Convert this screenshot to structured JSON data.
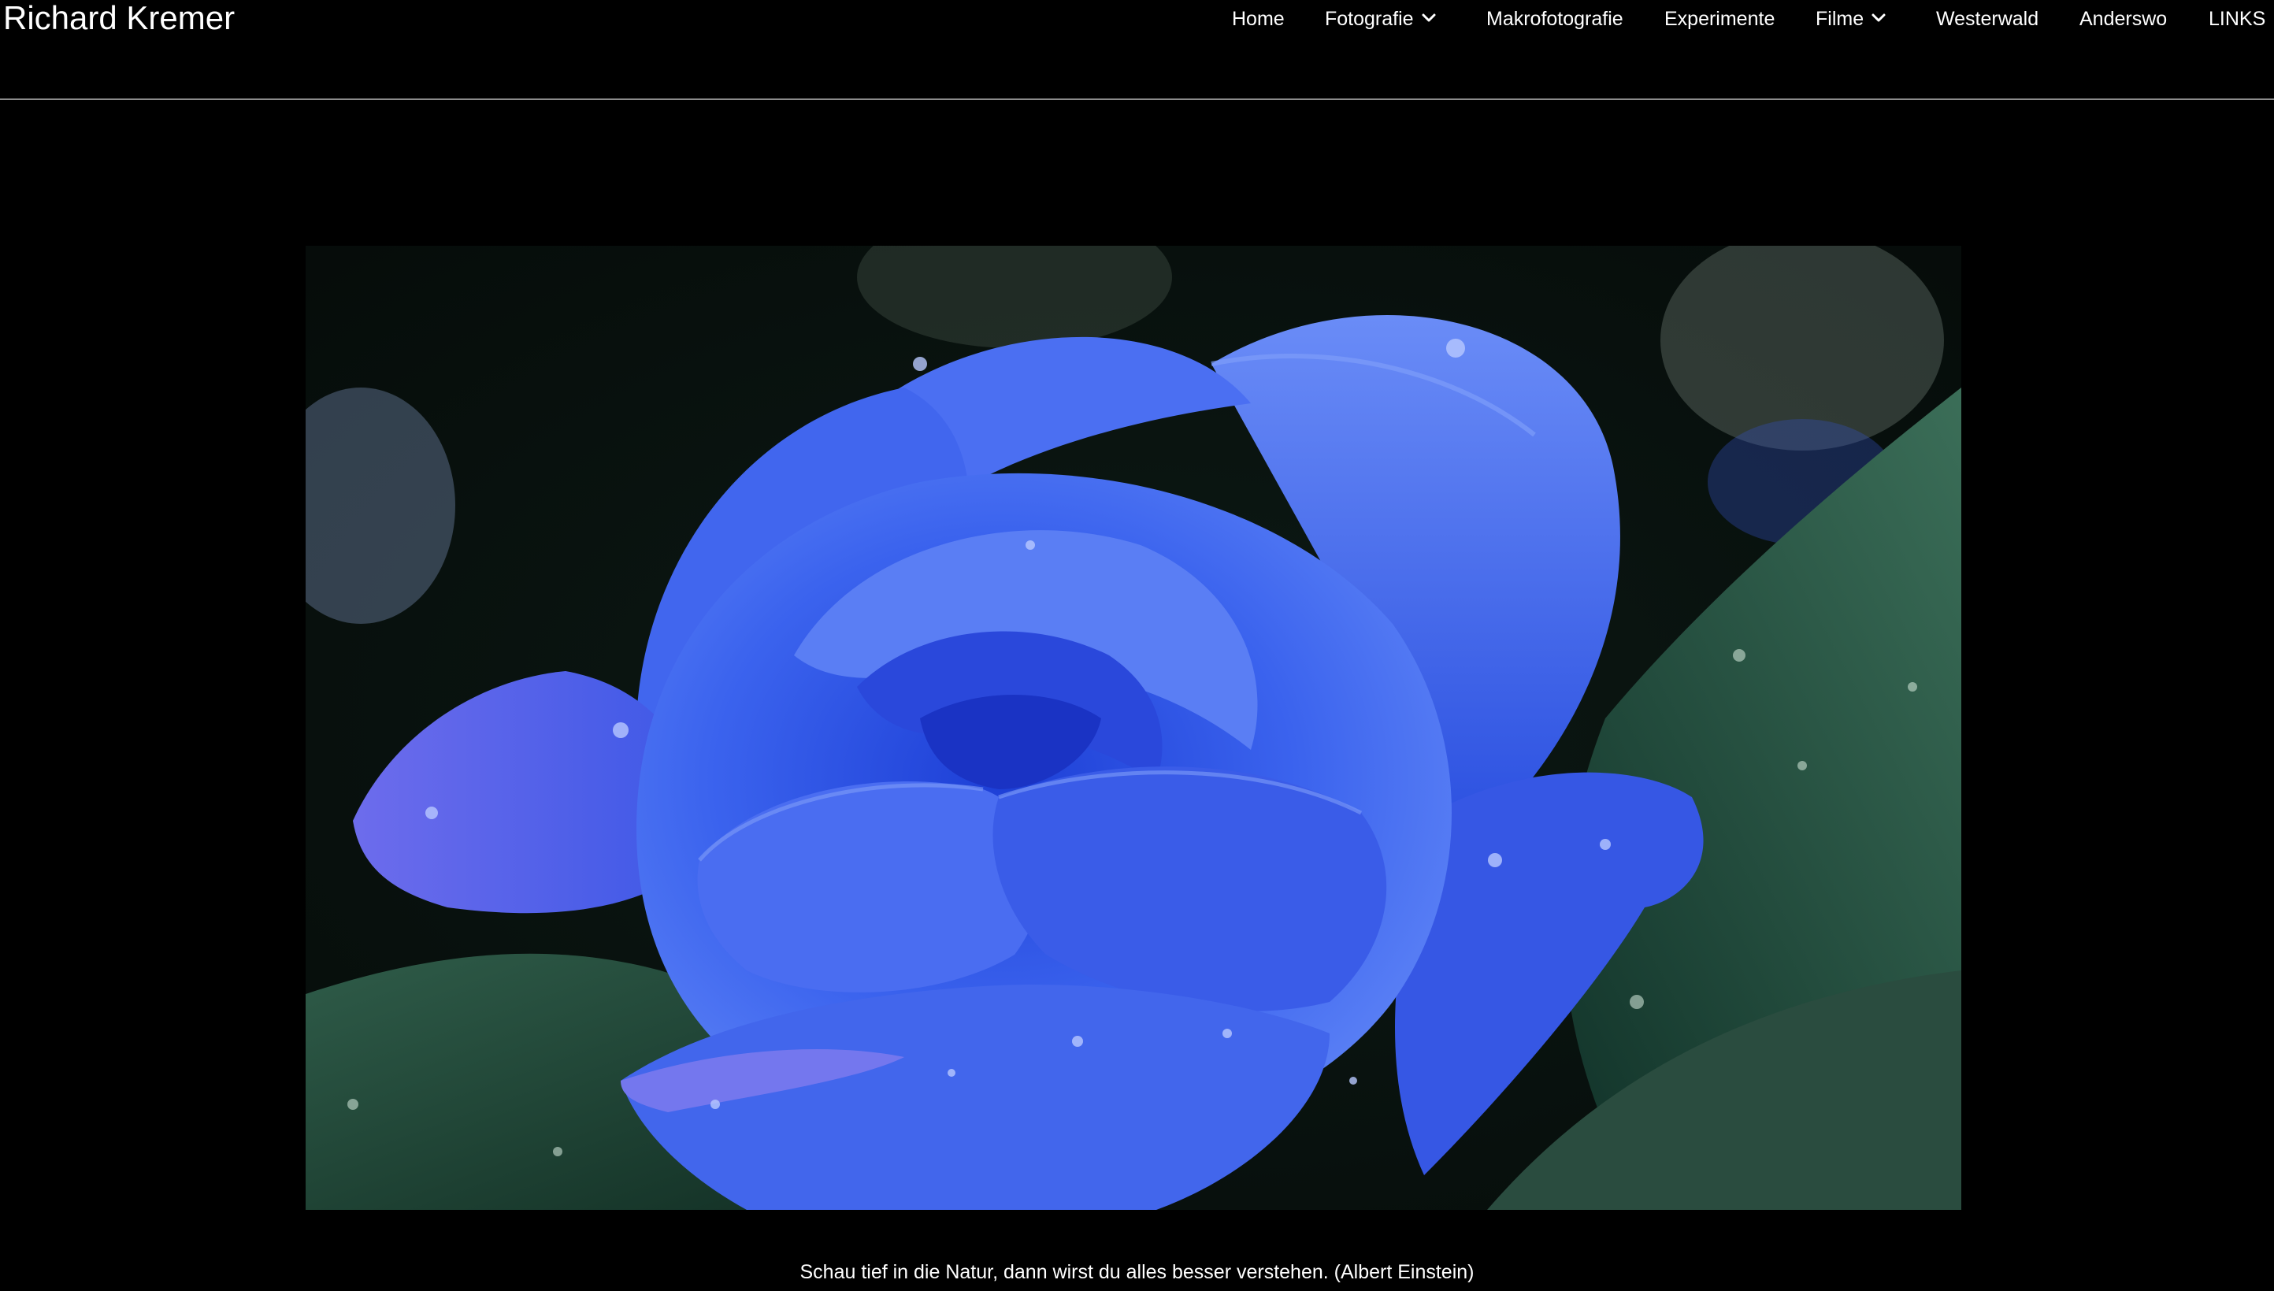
{
  "site": {
    "title": "Richard Kremer"
  },
  "nav": {
    "items": [
      {
        "label": "Home",
        "has_dropdown": false
      },
      {
        "label": "Fotografie",
        "has_dropdown": true
      },
      {
        "label": "Makrofotografie",
        "has_dropdown": false
      },
      {
        "label": "Experimente",
        "has_dropdown": false
      },
      {
        "label": "Filme",
        "has_dropdown": true
      },
      {
        "label": "Westerwald",
        "has_dropdown": false
      },
      {
        "label": "Anderswo",
        "has_dropdown": false
      },
      {
        "label": "LINKS",
        "has_dropdown": false
      }
    ]
  },
  "hero": {
    "subject": "blue-rose-photo"
  },
  "caption": {
    "text": "Schau tief in die Natur, dann wirst du alles besser verstehen. (Albert Einstein)"
  },
  "colors": {
    "background": "#000000",
    "text": "#ffffff",
    "divider": "#8c8c8c",
    "rose": "#3b5ee8",
    "leaf": "#1e4a38"
  },
  "icons": {
    "dropdown": "chevron-down-icon"
  }
}
